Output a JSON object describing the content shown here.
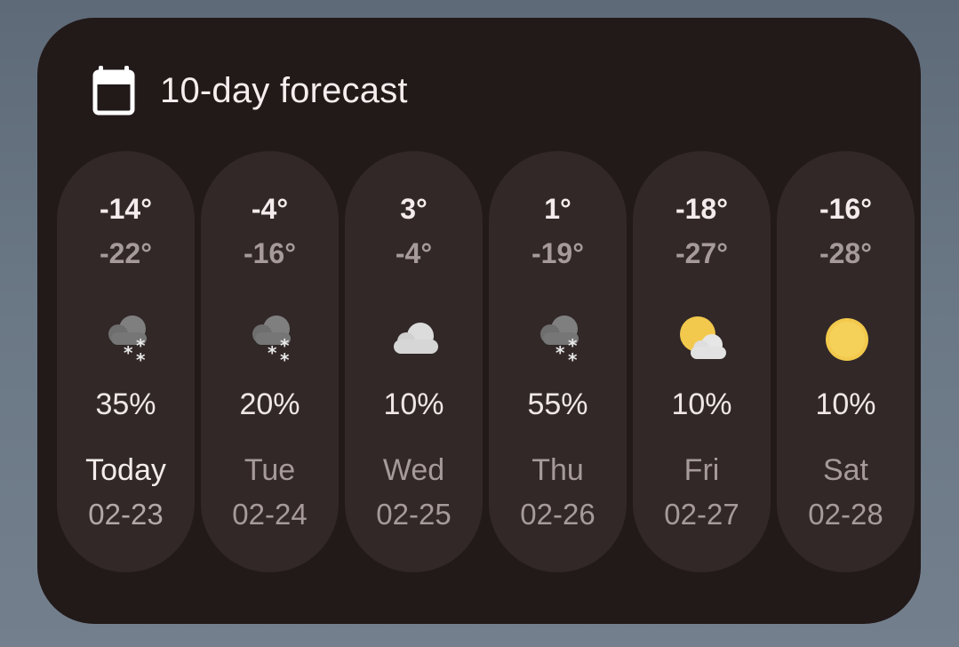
{
  "widget": {
    "title": "10-day forecast",
    "header_icon": "calendar-icon"
  },
  "days": [
    {
      "high": "-14°",
      "low": "-22°",
      "icon": "snow-cloud-icon",
      "precip": "35%",
      "day": "Today",
      "date": "02-23"
    },
    {
      "high": "-4°",
      "low": "-16°",
      "icon": "snow-cloud-icon",
      "precip": "20%",
      "day": "Tue",
      "date": "02-24"
    },
    {
      "high": "3°",
      "low": "-4°",
      "icon": "cloud-icon",
      "precip": "10%",
      "day": "Wed",
      "date": "02-25"
    },
    {
      "high": "1°",
      "low": "-19°",
      "icon": "snow-cloud-icon",
      "precip": "55%",
      "day": "Thu",
      "date": "02-26"
    },
    {
      "high": "-18°",
      "low": "-27°",
      "icon": "partly-cloudy-icon",
      "precip": "10%",
      "day": "Fri",
      "date": "02-27"
    },
    {
      "high": "-16°",
      "low": "-28°",
      "icon": "sun-icon",
      "precip": "10%",
      "day": "Sat",
      "date": "02-28"
    }
  ],
  "colors": {
    "widget_bg": "#221919",
    "pill_bg": "#322828",
    "text_primary": "#f4ecec",
    "text_secondary": "#a69a9a",
    "sun": "#f2c94c"
  }
}
